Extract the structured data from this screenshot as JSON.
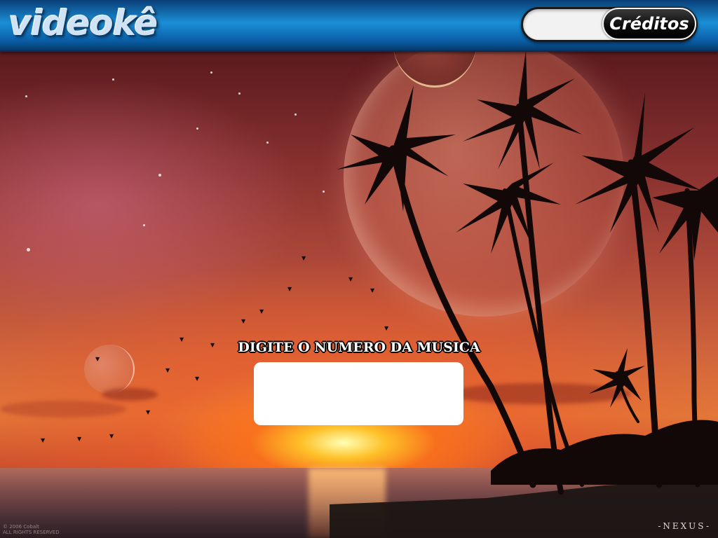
{
  "app": {
    "logo_text": "videokê",
    "credits_label": "Créditos"
  },
  "main": {
    "prompt": "DIGITE O NUMERO DA MUSICA",
    "song_number_value": ""
  },
  "wallpaper": {
    "signature": "-NEXUS-",
    "copyright_line1": "© 2006 Cobalt",
    "copyright_line2": "ALL RIGHTS RESERVED"
  },
  "colors": {
    "header_blue": "#1a8fd6",
    "credits_bg": "#000000",
    "input_bg": "#ffffff"
  }
}
